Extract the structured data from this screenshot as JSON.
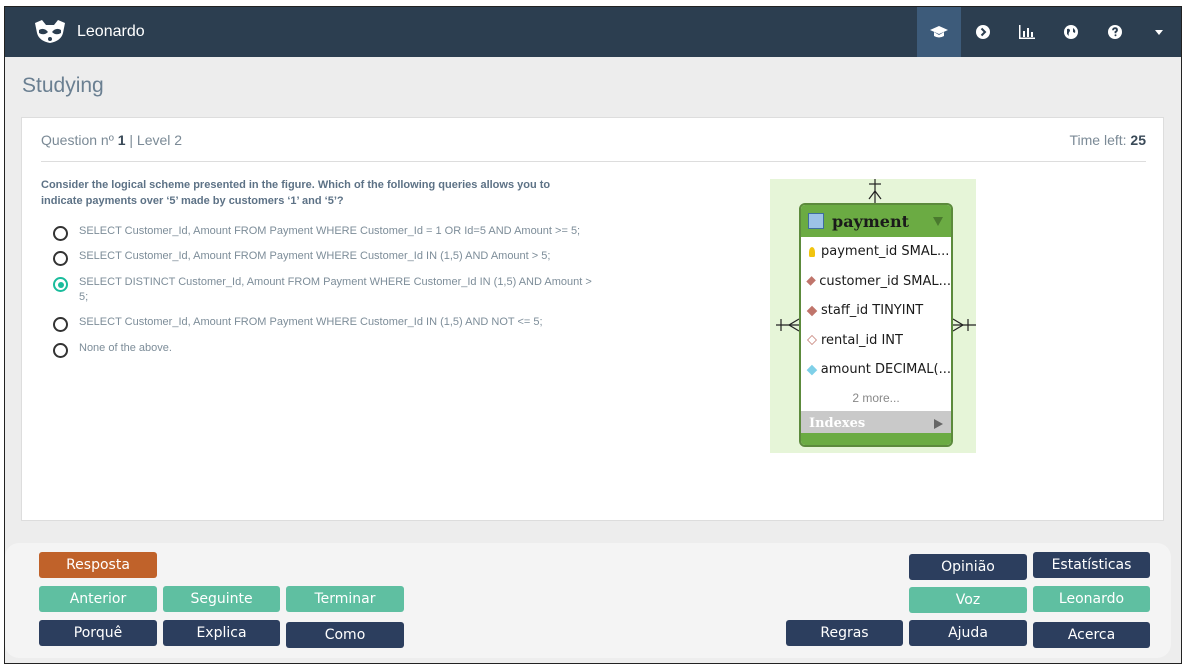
{
  "app": {
    "name": "Leonardo"
  },
  "page": {
    "title": "Studying"
  },
  "question": {
    "label": "Question nº",
    "number": "1",
    "level_text": "| Level 2",
    "time_label": "Time left:",
    "time_value": "25",
    "text": "Consider the logical scheme presented in the figure. Which of the following queries allows you to indicate payments over ‘5’ made by customers ‘1’ and ‘5’?",
    "options": [
      {
        "text": "SELECT Customer_Id, Amount FROM Payment WHERE Customer_Id = 1 OR Id=5 AND Amount >= 5;",
        "selected": false
      },
      {
        "text": "SELECT Customer_Id, Amount FROM Payment WHERE Customer_Id IN (1,5) AND Amount > 5;",
        "selected": false
      },
      {
        "text": "SELECT DISTINCT Customer_Id, Amount FROM Payment WHERE Customer_Id IN (1,5) AND Amount > 5;",
        "selected": true
      },
      {
        "text": "SELECT Customer_Id, Amount FROM Payment WHERE Customer_Id IN (1,5) AND NOT <= 5;",
        "selected": false
      },
      {
        "text": "None of the above.",
        "selected": false
      }
    ]
  },
  "diagram": {
    "entity_name": "payment",
    "fields": [
      {
        "icon": "key",
        "text": "payment_id SMAL..."
      },
      {
        "icon": "fk",
        "text": "customer_id SMAL..."
      },
      {
        "icon": "fk",
        "text": "staff_id TINYINT"
      },
      {
        "icon": "nn",
        "text": "rental_id INT"
      },
      {
        "icon": "dec",
        "text": "amount DECIMAL(..."
      }
    ],
    "more": "2 more...",
    "indexes": "Indexes"
  },
  "buttons": {
    "resposta": "Resposta",
    "anterior": "Anterior",
    "seguinte": "Seguinte",
    "terminar": "Terminar",
    "porque": "Porquê",
    "explica": "Explica",
    "como": "Como",
    "opiniao": "Opinião",
    "estatisticas": "Estatísticas",
    "voz": "Voz",
    "leonardo": "Leonardo",
    "regras": "Regras",
    "ajuda": "Ajuda",
    "acerca": "Acerca"
  },
  "colors": {
    "navbar": "#2c3e50",
    "orange": "#c0622a",
    "teal": "#5fbfa1",
    "navy": "#2c3e5e",
    "accent": "#1abc9c"
  }
}
